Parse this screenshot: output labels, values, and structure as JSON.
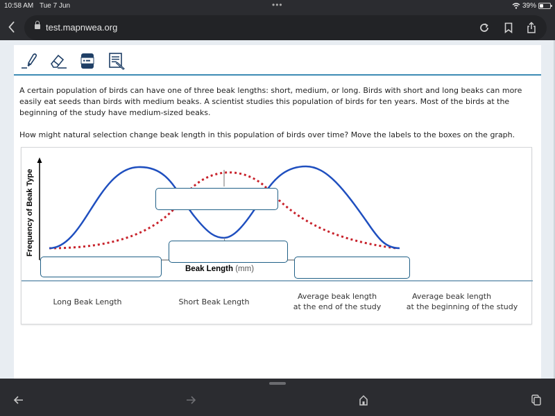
{
  "status_bar": {
    "time": "10:58 AM",
    "date": "Tue 7 Jun",
    "battery_percent_label": "39%",
    "battery_level": 0.39
  },
  "browser": {
    "url": "test.mapnwea.org",
    "icons": [
      "back-icon",
      "lock-icon",
      "reload-icon",
      "bookmark-icon",
      "share-icon"
    ]
  },
  "tools": [
    {
      "name": "highlighter",
      "icon": "highlighter-icon"
    },
    {
      "name": "eraser",
      "icon": "eraser-icon"
    },
    {
      "name": "answer-masking",
      "icon": "line-reader-icon"
    },
    {
      "name": "notepad",
      "icon": "notepad-icon"
    }
  ],
  "question": {
    "stem": "A certain population of birds can have one of three beak lengths: short, medium, or long. Birds with short and long beaks can more easily eat seeds than birds with medium beaks. A scientist studies this population of birds for ten years. Most of the birds at the beginning of the study have medium-sized beaks.",
    "prompt": "How might natural selection change beak length in this population of birds over time? Move the labels to the boxes on the graph."
  },
  "graph": {
    "y_axis_label": "Frequency of  Beak Type",
    "x_axis_label_bold": "Beak Length",
    "x_axis_label_unit": " (mm)",
    "curves": [
      {
        "name": "end of study",
        "style": "solid",
        "color": "#1f4fbf",
        "shape": "bimodal"
      },
      {
        "name": "beginning of study",
        "style": "dotted",
        "color": "#c8232c",
        "shape": "unimodal"
      }
    ],
    "drop_boxes": [
      {
        "id": "top-center",
        "value": ""
      },
      {
        "id": "bottom-center",
        "value": ""
      },
      {
        "id": "bottom-left",
        "value": ""
      },
      {
        "id": "bottom-right",
        "value": ""
      }
    ]
  },
  "labels": [
    {
      "line1": "Long Beak Length",
      "line2": ""
    },
    {
      "line1": "Short Beak Length",
      "line2": ""
    },
    {
      "line1": "Average beak length",
      "line2": "at the end of the study"
    },
    {
      "line1": "Average beak length",
      "line2": "at the beginning of the study"
    }
  ]
}
